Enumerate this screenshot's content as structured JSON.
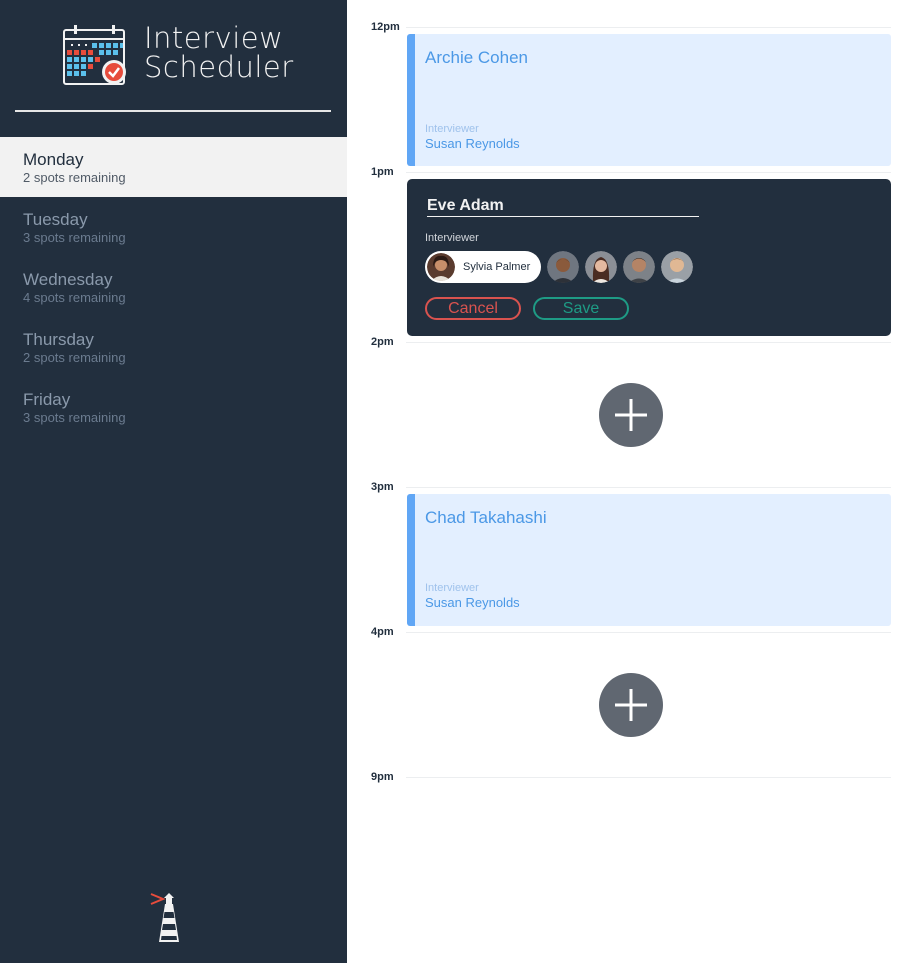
{
  "app": {
    "title_line1": "Interview",
    "title_line2": "Scheduler",
    "logo_icon": "calendar-check-icon",
    "footer_icon": "lighthouse-icon"
  },
  "days": [
    {
      "name": "Monday",
      "spots": "2 spots remaining",
      "selected": true
    },
    {
      "name": "Tuesday",
      "spots": "3 spots remaining",
      "selected": false
    },
    {
      "name": "Wednesday",
      "spots": "4 spots remaining",
      "selected": false
    },
    {
      "name": "Thursday",
      "spots": "2 spots remaining",
      "selected": false
    },
    {
      "name": "Friday",
      "spots": "3 spots remaining",
      "selected": false
    }
  ],
  "times": [
    "12pm",
    "1pm",
    "2pm",
    "3pm",
    "4pm",
    "9pm"
  ],
  "appointments": [
    {
      "student": "Archie Cohen",
      "interviewer_label": "Interviewer",
      "interviewer": "Susan Reynolds"
    },
    {
      "student": "Chad Takahashi",
      "interviewer_label": "Interviewer",
      "interviewer": "Susan Reynolds"
    }
  ],
  "form": {
    "student_value": "Eve Adam",
    "interviewer_label": "Interviewer",
    "selected_interviewer": "Sylvia Palmer",
    "cancel_label": "Cancel",
    "save_label": "Save"
  },
  "colors": {
    "sidebar": "#222f3e",
    "appointment_bg": "#e3efff",
    "appointment_accent": "#60a6f5",
    "cancel": "#d9534f",
    "save": "#1e9b85",
    "add_button": "#606771"
  }
}
